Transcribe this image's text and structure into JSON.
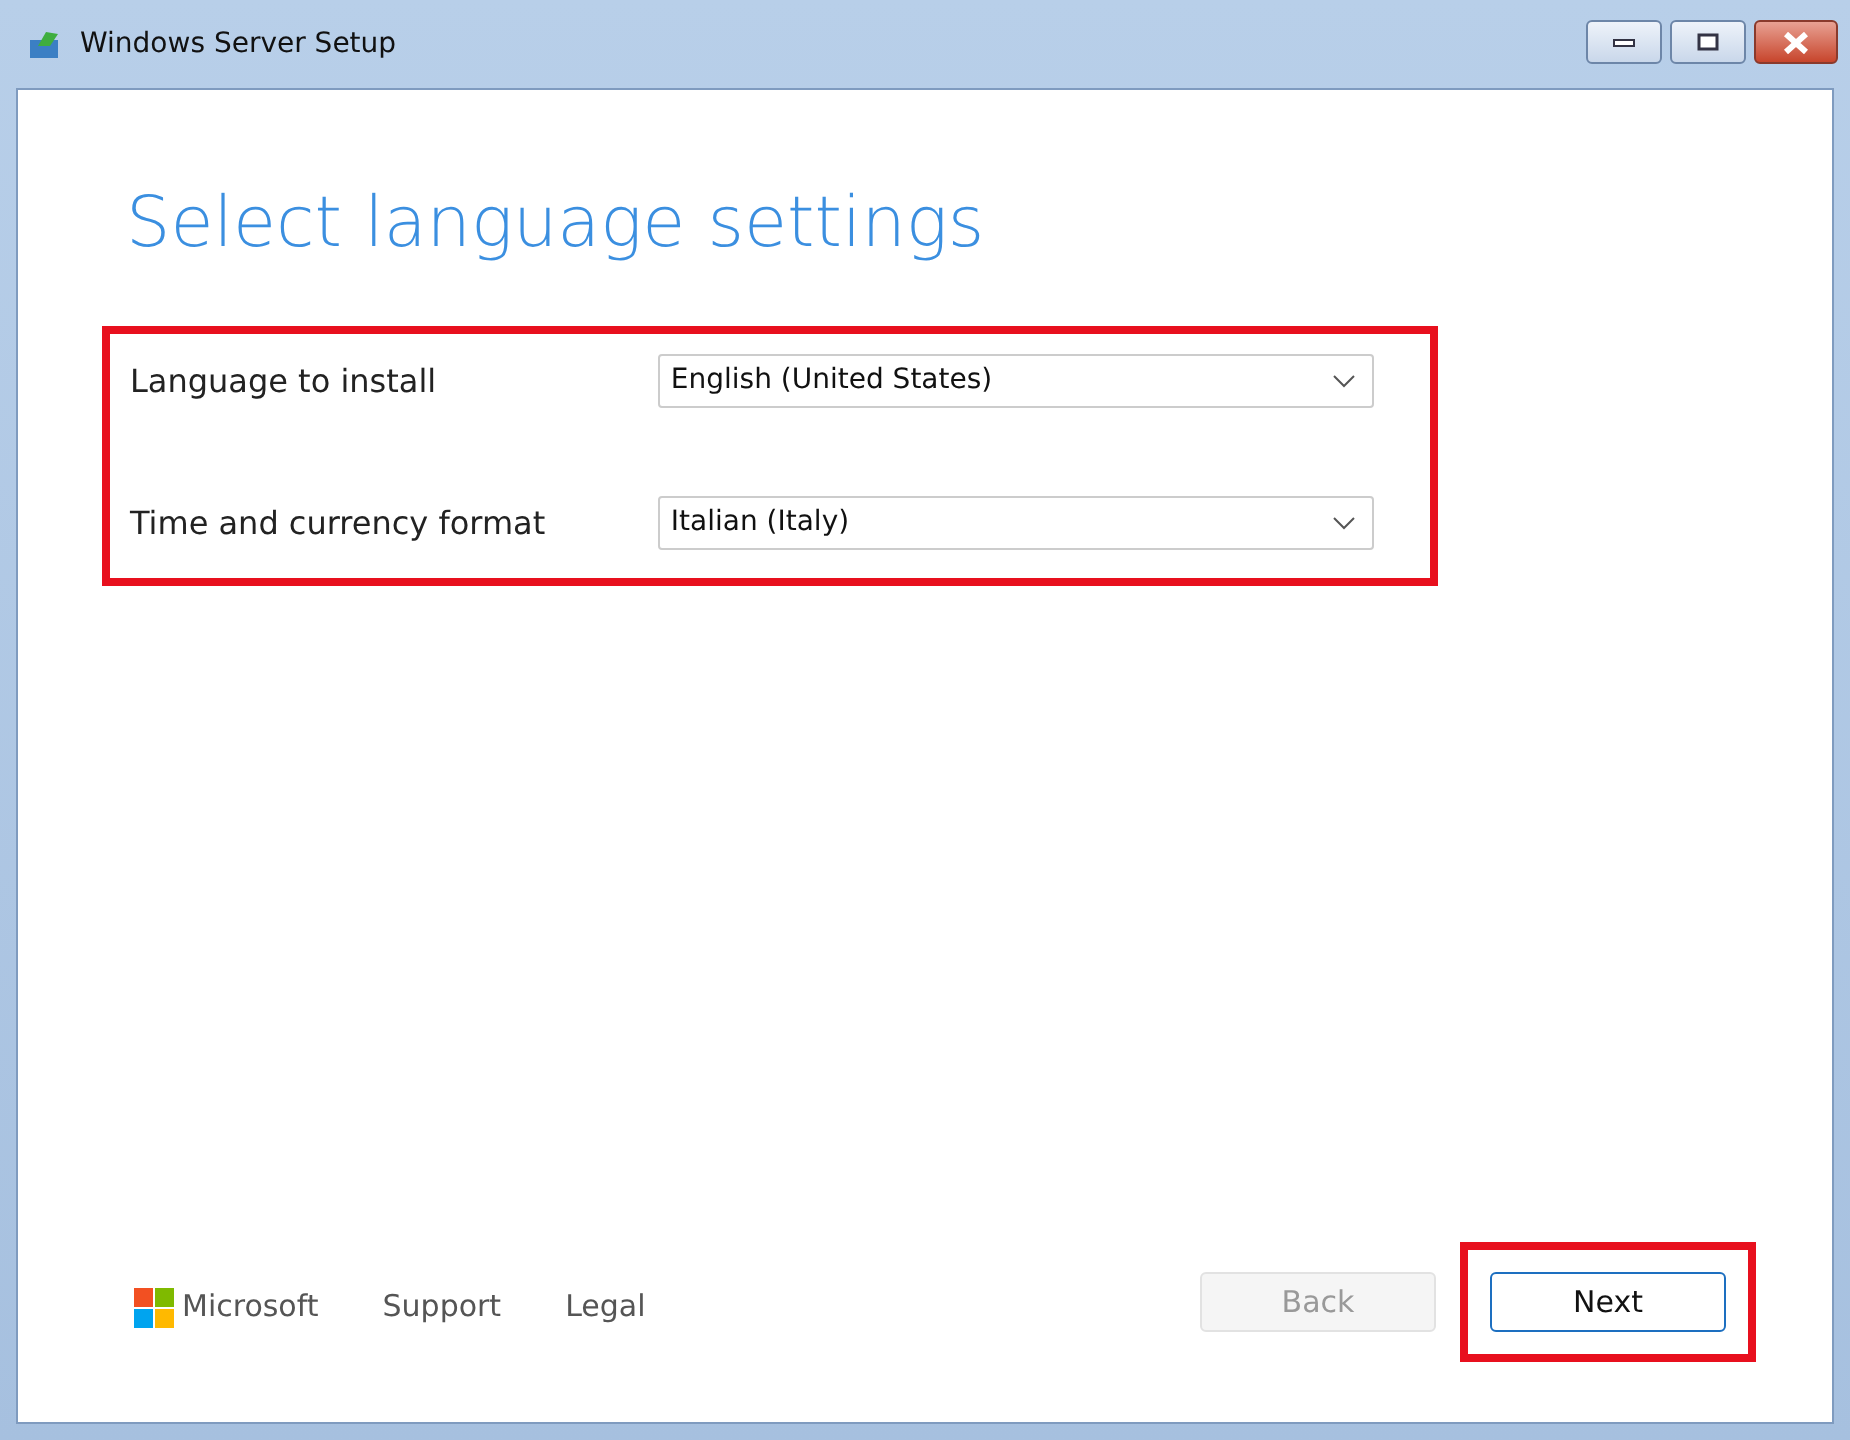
{
  "window": {
    "title": "Windows Server Setup"
  },
  "heading": "Select language settings",
  "settings": {
    "highlighted": true,
    "rows": [
      {
        "label": "Language to install",
        "value": "English (United States)"
      },
      {
        "label": "Time and currency format",
        "value": "Italian (Italy)"
      }
    ]
  },
  "footer": {
    "brand": "Microsoft",
    "links": [
      "Support",
      "Legal"
    ]
  },
  "buttons": [
    {
      "label": "Back",
      "disabled": true,
      "highlighted": false
    },
    {
      "label": "Next",
      "disabled": false,
      "highlighted": true
    }
  ]
}
